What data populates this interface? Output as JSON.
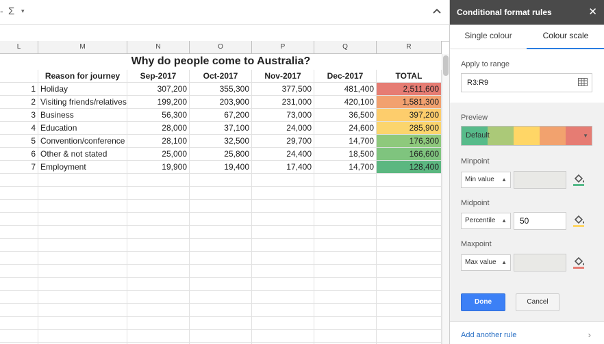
{
  "toolbar": {
    "dash": "-",
    "sigma": "Σ",
    "caret": "▾",
    "collapse_icon": "chevron-up-icon"
  },
  "columns": [
    "L",
    "M",
    "N",
    "O",
    "P",
    "Q",
    "R"
  ],
  "sheet": {
    "title": "Why do people come to Australia?",
    "headers": [
      "Reason for journey",
      "Sep-2017",
      "Oct-2017",
      "Nov-2017",
      "Dec-2017",
      "TOTAL"
    ],
    "rows": [
      {
        "n": "1",
        "reason": "Holiday",
        "sep": "307,200",
        "oct": "355,300",
        "nov": "377,500",
        "dec": "481,400",
        "total": "2,511,600",
        "color": "#e67c73"
      },
      {
        "n": "2",
        "reason": "Visiting friends/relatives",
        "sep": "199,200",
        "oct": "203,900",
        "nov": "231,000",
        "dec": "420,100",
        "total": "1,581,300",
        "color": "#f2a16f"
      },
      {
        "n": "3",
        "reason": "Business",
        "sep": "56,300",
        "oct": "67,200",
        "nov": "73,000",
        "dec": "36,500",
        "total": "397,200",
        "color": "#fdcd6c"
      },
      {
        "n": "4",
        "reason": "Education",
        "sep": "28,000",
        "oct": "37,100",
        "nov": "24,000",
        "dec": "24,600",
        "total": "285,900",
        "color": "#fbd56d"
      },
      {
        "n": "5",
        "reason": "Convention/conference",
        "sep": "28,100",
        "oct": "32,500",
        "nov": "29,700",
        "dec": "14,700",
        "total": "176,300",
        "color": "#8ec97c"
      },
      {
        "n": "6",
        "reason": "Other & not stated",
        "sep": "25,000",
        "oct": "25,800",
        "nov": "24,400",
        "dec": "18,500",
        "total": "166,600",
        "color": "#7fc47e"
      },
      {
        "n": "7",
        "reason": "Employment",
        "sep": "19,900",
        "oct": "19,400",
        "nov": "17,400",
        "dec": "14,700",
        "total": "128,400",
        "color": "#5bb780"
      }
    ]
  },
  "panel": {
    "title": "Conditional format rules",
    "close": "✕",
    "tabs": [
      "Single colour",
      "Colour scale"
    ],
    "apply_label": "Apply to range",
    "range": "R3:R9",
    "preview_label": "Preview",
    "preview_text": "Default",
    "preview_colors": [
      "#57bb8a",
      "#abc978",
      "#ffd666",
      "#f2a26e",
      "#e67c73"
    ],
    "minpoint_label": "Minpoint",
    "min_type": "Min value",
    "min_color": "#57bb8a",
    "midpoint_label": "Midpoint",
    "mid_type": "Percentile",
    "mid_value": "50",
    "mid_color": "#ffd666",
    "maxpoint_label": "Maxpoint",
    "max_type": "Max value",
    "max_color": "#e67c73",
    "done": "Done",
    "cancel": "Cancel",
    "add_rule": "Add another rule"
  }
}
